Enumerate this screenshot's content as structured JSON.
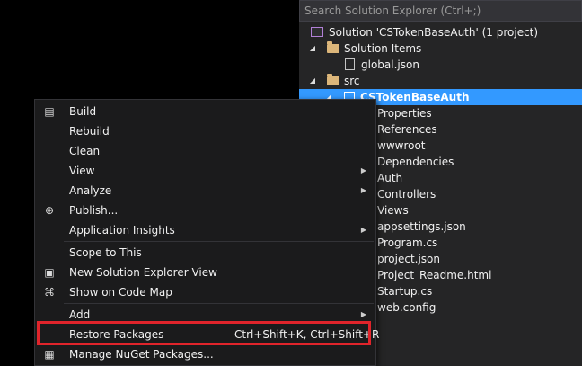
{
  "explorer": {
    "search_placeholder": "Search Solution Explorer (Ctrl+;)",
    "selection_color": "#3399ff",
    "tree": {
      "solution": "Solution 'CSTokenBaseAuth' (1 project)",
      "solution_items": "Solution Items",
      "global_json": "global.json",
      "src": "src",
      "project": "CSTokenBaseAuth",
      "children": [
        "Properties",
        "References",
        "wwwroot",
        "Dependencies",
        "Auth",
        "Controllers",
        "Views",
        "appsettings.json",
        "Program.cs",
        "project.json",
        "Project_Readme.html",
        "Startup.cs",
        "web.config"
      ]
    }
  },
  "menu": {
    "build": "Build",
    "rebuild": "Rebuild",
    "clean": "Clean",
    "view": "View",
    "analyze": "Analyze",
    "publish": "Publish...",
    "app_insights": "Application Insights",
    "scope": "Scope to This",
    "new_view": "New Solution Explorer View",
    "code_map": "Show on Code Map",
    "add": "Add",
    "restore": "Restore Packages",
    "restore_shortcut": "Ctrl+Shift+K, Ctrl+Shift+R",
    "manage_nuget": "Manage NuGet Packages...",
    "highlight_color": "#e0242b"
  }
}
